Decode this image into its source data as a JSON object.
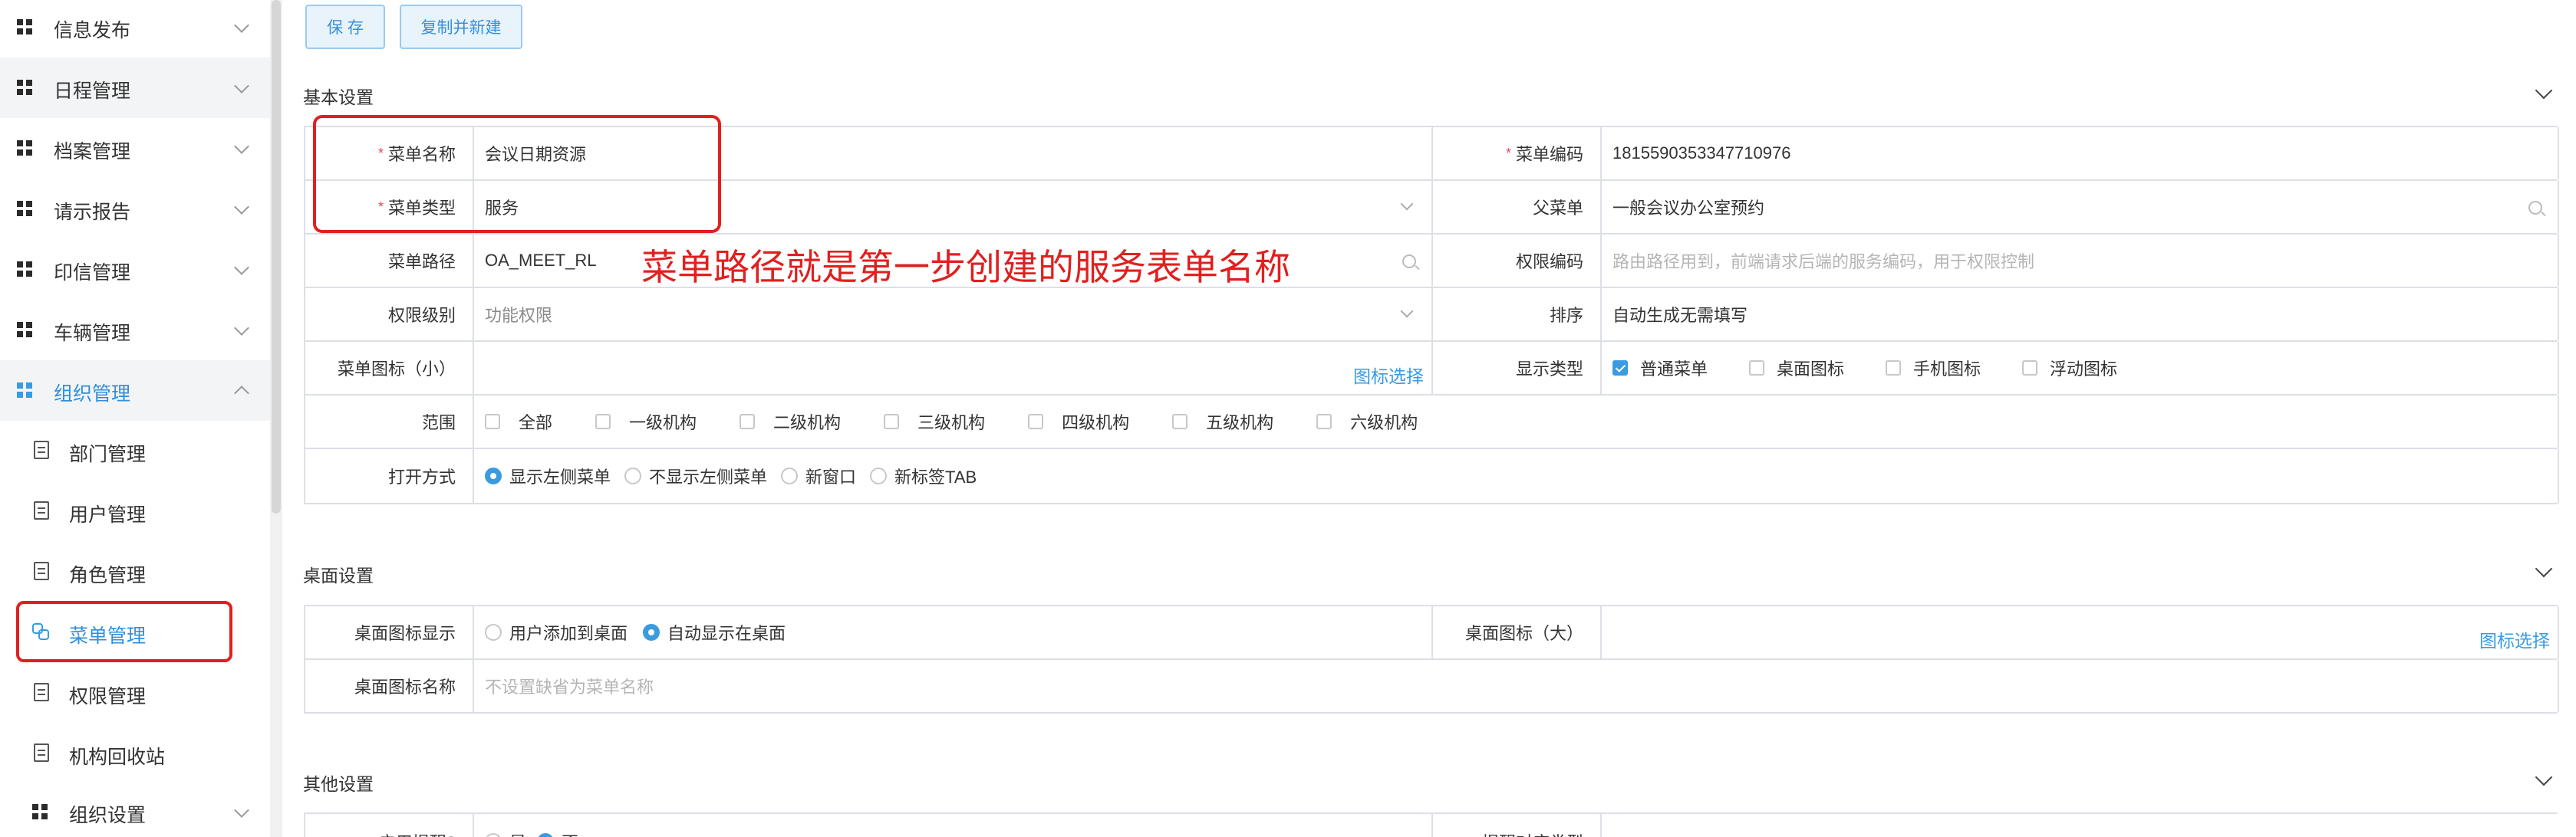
{
  "sidebar": {
    "items": [
      {
        "label": "信息发布",
        "icon": "grid-icon"
      },
      {
        "label": "日程管理",
        "icon": "grid-icon"
      },
      {
        "label": "档案管理",
        "icon": "grid-icon"
      },
      {
        "label": "请示报告",
        "icon": "grid-icon"
      },
      {
        "label": "印信管理",
        "icon": "grid-icon"
      },
      {
        "label": "车辆管理",
        "icon": "grid-icon"
      },
      {
        "label": "组织管理",
        "icon": "grid-icon",
        "expanded": true
      }
    ],
    "sub_items": [
      {
        "label": "部门管理",
        "icon": "document-icon"
      },
      {
        "label": "用户管理",
        "icon": "document-icon"
      },
      {
        "label": "角色管理",
        "icon": "document-icon"
      },
      {
        "label": "菜单管理",
        "icon": "menu-icon",
        "active": true
      },
      {
        "label": "权限管理",
        "icon": "document-icon"
      },
      {
        "label": "机构回收站",
        "icon": "document-icon"
      }
    ],
    "last_item": {
      "label": "组织设置",
      "icon": "grid-icon"
    }
  },
  "toolbar": {
    "save_label": "保 存",
    "copy_new_label": "复制并新建"
  },
  "sections": {
    "basic": "基本设置",
    "desktop": "桌面设置",
    "other": "其他设置"
  },
  "basic": {
    "menu_name_label": "菜单名称",
    "menu_name_value": "会议日期资源",
    "menu_code_label": "菜单编码",
    "menu_code_value": "1815590353347710976",
    "menu_type_label": "菜单类型",
    "menu_type_value": "服务",
    "parent_menu_label": "父菜单",
    "parent_menu_value": "一般会议办公室预约",
    "menu_path_label": "菜单路径",
    "menu_path_value": "OA_MEET_RL",
    "perm_code_label": "权限编码",
    "perm_code_placeholder": "路由路径用到，前端请求后端的服务编码，用于权限控制",
    "perm_level_label": "权限级别",
    "perm_level_value": "功能权限",
    "order_label": "排序",
    "order_value": "自动生成无需填写",
    "icon_small_label": "菜单图标（小）",
    "icon_select_link": "图标选择",
    "display_type_label": "显示类型",
    "display_types": [
      {
        "label": "普通菜单",
        "checked": true
      },
      {
        "label": "桌面图标",
        "checked": false
      },
      {
        "label": "手机图标",
        "checked": false
      },
      {
        "label": "浮动图标",
        "checked": false
      }
    ],
    "scope_label": "范围",
    "scopes": [
      "全部",
      "一级机构",
      "二级机构",
      "三级机构",
      "四级机构",
      "五级机构",
      "六级机构"
    ],
    "open_mode_label": "打开方式",
    "open_modes": [
      {
        "label": "显示左侧菜单",
        "selected": true
      },
      {
        "label": "不显示左侧菜单",
        "selected": false
      },
      {
        "label": "新窗口",
        "selected": false
      },
      {
        "label": "新标签TAB",
        "selected": false
      }
    ]
  },
  "desktop": {
    "icon_display_label": "桌面图标显示",
    "icon_display_options": [
      {
        "label": "用户添加到桌面",
        "selected": false
      },
      {
        "label": "自动显示在桌面",
        "selected": true
      }
    ],
    "icon_large_label": "桌面图标（大）",
    "icon_select_link": "图标选择",
    "icon_name_label": "桌面图标名称",
    "icon_name_placeholder": "不设置缺省为菜单名称"
  },
  "other": {
    "enable_reminder_label": "启用提醒?",
    "yes_label": "是",
    "no_label": "否",
    "reminder_type_label": "提醒对应类型"
  },
  "annotation": {
    "text": "菜单路径就是第一步创建的服务表单名称"
  },
  "colors": {
    "accent": "#3a9be0",
    "annotation": "#e02020",
    "border": "#dcdfe6"
  }
}
